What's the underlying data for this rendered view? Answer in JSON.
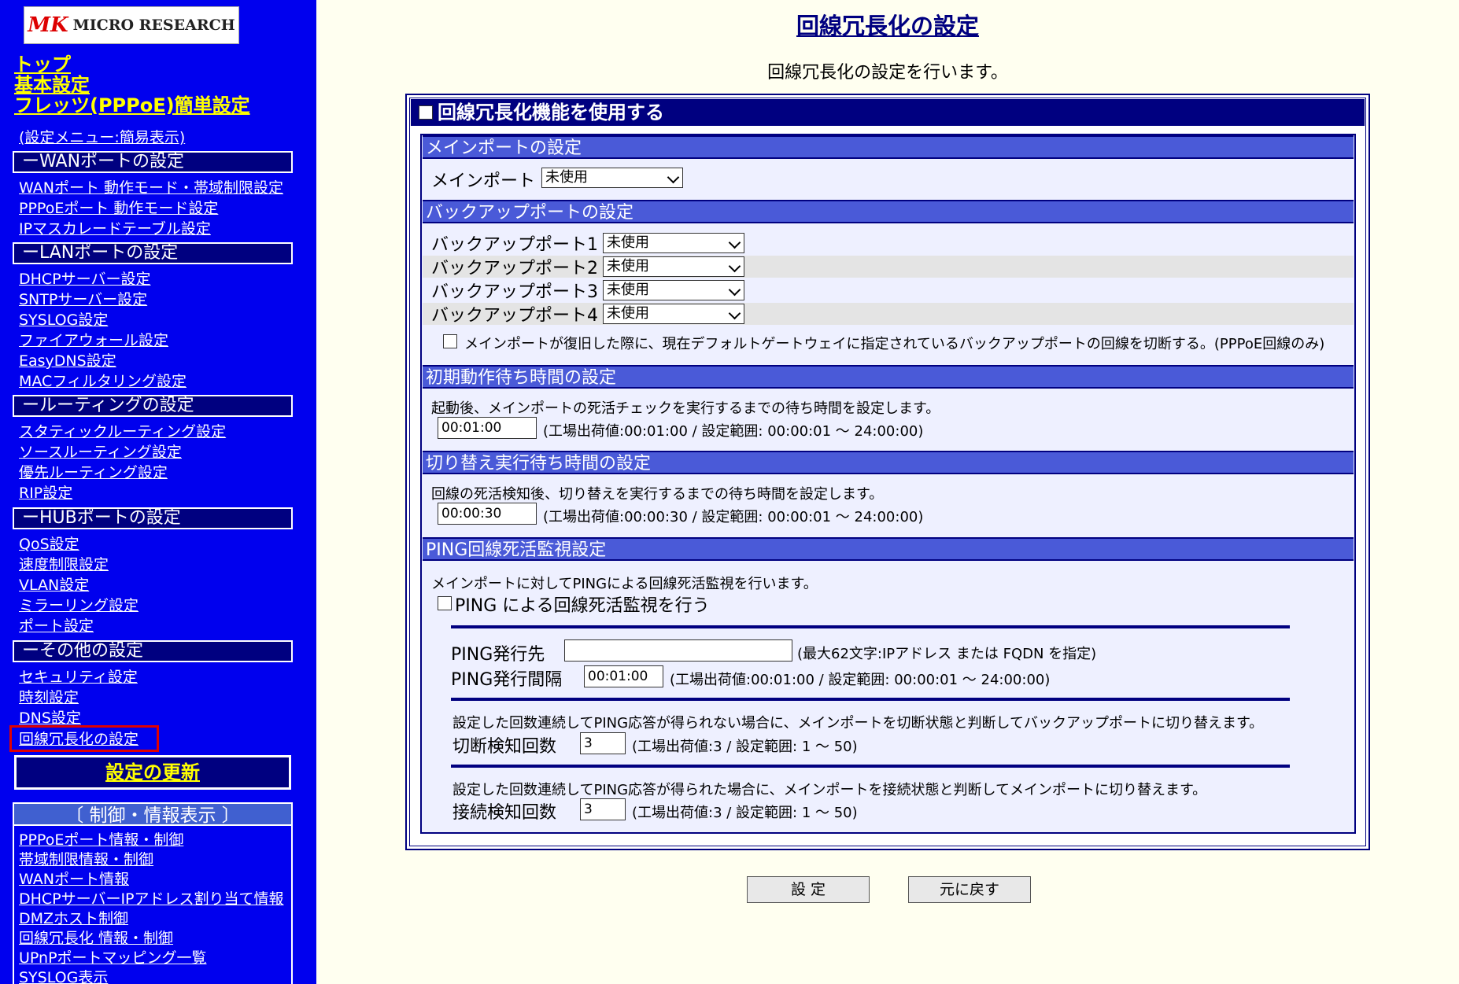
{
  "logo": {
    "mark": "MK",
    "text": "MICRO RESEARCH"
  },
  "sidebar": {
    "top_links": [
      "トップ",
      "基本設定",
      "フレッツ(PPPoE)簡単設定"
    ],
    "menu_mode": "(設定メニュー:簡易表示)",
    "sections": [
      {
        "title": "ーWANポートの設定",
        "items": [
          "WANポート 動作モード・帯域制限設定",
          "PPPoEポート 動作モード設定",
          "IPマスカレードテーブル設定"
        ]
      },
      {
        "title": "ーLANポートの設定",
        "items": [
          "DHCPサーバー設定",
          "SNTPサーバー設定",
          "SYSLOG設定",
          "ファイアウォール設定",
          "EasyDNS設定",
          "MACフィルタリング設定"
        ]
      },
      {
        "title": "ールーティングの設定",
        "items": [
          "スタティックルーティング設定",
          "ソースルーティング設定",
          "優先ルーティング設定",
          "RIP設定"
        ]
      },
      {
        "title": "ーHUBポートの設定",
        "items": [
          "QoS設定",
          "速度制限設定",
          "VLAN設定",
          "ミラーリング設定",
          "ポート設定"
        ]
      },
      {
        "title": "ーその他の設定",
        "items": [
          "セキュリティ設定",
          "時刻設定",
          "DNS設定",
          "回線冗長化の設定"
        ]
      }
    ],
    "update_button": "設定の更新",
    "control": {
      "title": "〔 制御・情報表示 〕",
      "items": [
        "PPPoEポート情報・制御",
        "帯域制限情報・制御",
        "WANポート情報",
        "DHCPサーバーIPアドレス割り当て情報",
        "DMZホスト制御",
        "回線冗長化 情報・制御",
        "UPnPポートマッピング一覧",
        "SYSLOG表示"
      ]
    },
    "accent_active": "#e00000"
  },
  "main": {
    "title": "回線冗長化の設定",
    "description": "回線冗長化の設定を行います。",
    "feature_toggle": "回線冗長化機能を使用する",
    "main_port": {
      "header": "メインポートの設定",
      "label": "メインポート",
      "value": "未使用"
    },
    "backup": {
      "header": "バックアップポートの設定",
      "ports": [
        {
          "label": "バックアップポート1",
          "value": "未使用"
        },
        {
          "label": "バックアップポート2",
          "value": "未使用"
        },
        {
          "label": "バックアップポート3",
          "value": "未使用"
        },
        {
          "label": "バックアップポート4",
          "value": "未使用"
        }
      ],
      "disconnect_option": "メインポートが復旧した際に、現在デフォルトゲートウェイに指定されているバックアップポートの回線を切断する。(PPPoE回線のみ)"
    },
    "initial_wait": {
      "header": "初期動作待ち時間の設定",
      "description": "起動後、メインポートの死活チェックを実行するまでの待ち時間を設定します。",
      "value": "00:01:00",
      "hint": "(工場出荷値:00:01:00 / 設定範囲: 00:00:01 〜 24:00:00)"
    },
    "switch_wait": {
      "header": "切り替え実行待ち時間の設定",
      "description": "回線の死活検知後、切り替えを実行するまでの待ち時間を設定します。",
      "value": "00:00:30",
      "hint": "(工場出荷値:00:00:30 / 設定範囲: 00:00:01 〜 24:00:00)"
    },
    "ping": {
      "header": "PING回線死活監視設定",
      "description": "メインポートに対してPINGによる回線死活監視を行います。",
      "enable_label": "PING による回線死活監視を行う",
      "target_label": "PING発行先",
      "target_value": "",
      "target_hint": "(最大62文字:IPアドレス または FQDN を指定)",
      "interval_label": "PING発行間隔",
      "interval_value": "00:01:00",
      "interval_hint": "(工場出荷値:00:01:00 / 設定範囲: 00:00:01 〜 24:00:00)",
      "fail_description": "設定した回数連続してPING応答が得られない場合に、メインポートを切断状態と判断してバックアップポートに切り替えます。",
      "fail_label": "切断検知回数",
      "fail_value": "3",
      "fail_hint": "(工場出荷値:3 / 設定範囲: 1 〜 50)",
      "ok_description": "設定した回数連続してPING応答が得られた場合に、メインポートを接続状態と判断してメインポートに切り替えます。",
      "ok_label": "接続検知回数",
      "ok_value": "3",
      "ok_hint": "(工場出荷値:3 / 設定範囲: 1 〜 50)"
    },
    "buttons": {
      "apply": "設 定",
      "revert": "元に戻す"
    }
  }
}
